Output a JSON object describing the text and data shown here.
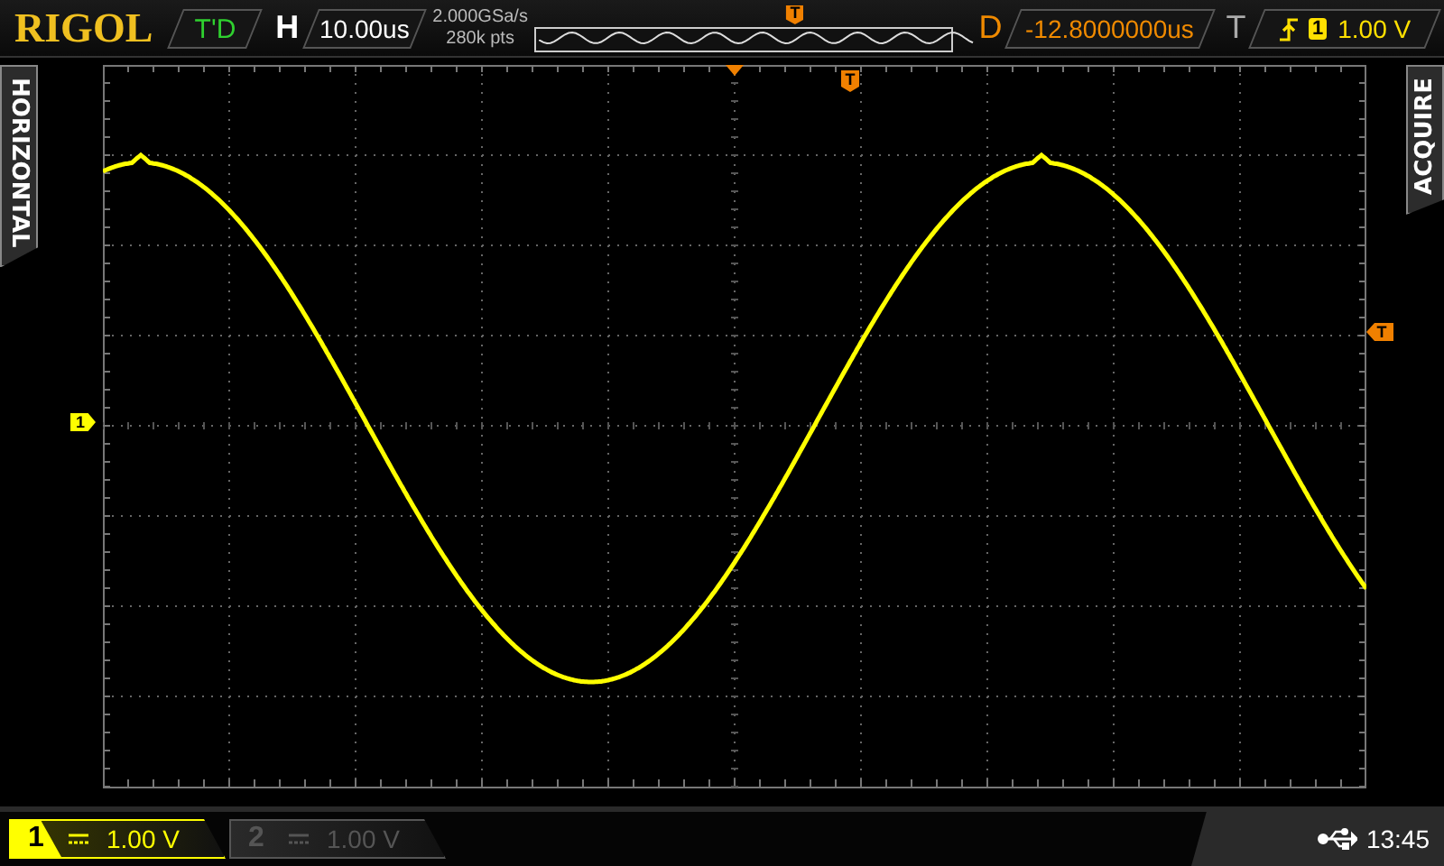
{
  "logo": "RIGOL",
  "run_status": "T'D",
  "timebase": {
    "label": "H",
    "value": "10.00us"
  },
  "acquisition": {
    "sample_rate": "2.000GSa/s",
    "memory_depth": "280k pts",
    "trigger_marker": "T"
  },
  "delay": {
    "label": "D",
    "value": "-12.8000000us"
  },
  "trigger": {
    "label": "T",
    "channel": "1",
    "level": "1.00 V"
  },
  "side_tabs": {
    "left": "HORIZONTAL",
    "right": "ACQUIRE"
  },
  "screen_markers": {
    "trigger_position": "T",
    "trigger_level": "T",
    "channel": "1"
  },
  "channels": [
    {
      "number": "1",
      "scale": "1.00 V",
      "on": true
    },
    {
      "number": "2",
      "scale": "1.00 V",
      "on": false
    }
  ],
  "status_bar": {
    "time": "13:45"
  }
}
